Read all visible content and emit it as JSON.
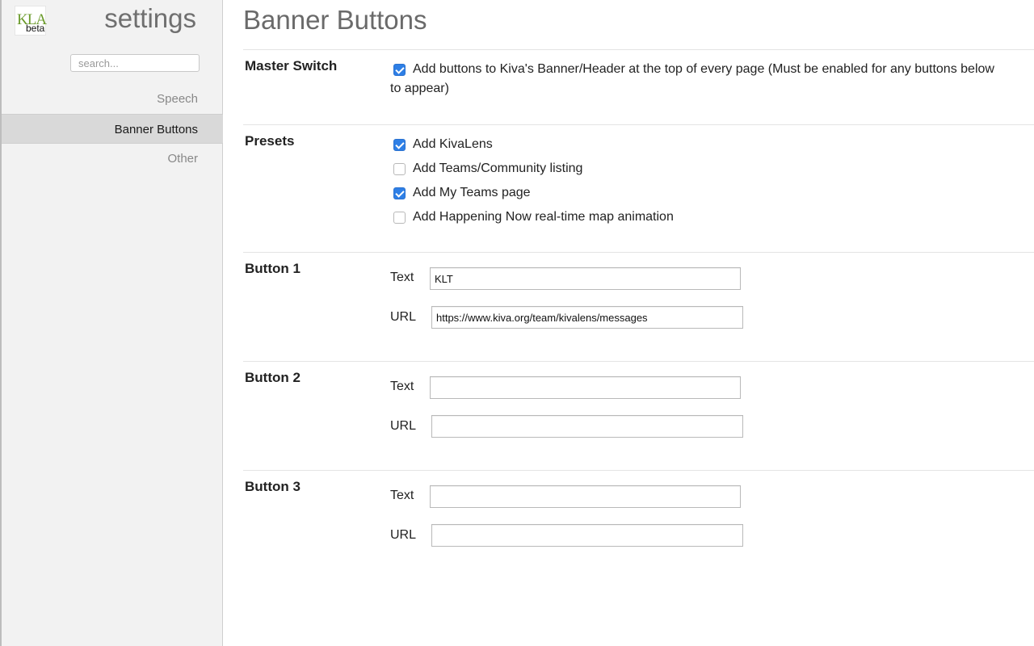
{
  "sidebar": {
    "logo_text": "KLA",
    "logo_beta": "beta",
    "title": "settings",
    "search_placeholder": "search...",
    "nav": [
      {
        "label": "Speech"
      },
      {
        "label": "Banner Buttons"
      },
      {
        "label": "Other"
      }
    ]
  },
  "main": {
    "title": "Banner Buttons",
    "master": {
      "label": "Master Switch",
      "checkbox_text": "Add buttons to Kiva's Banner/Header at the top of every page (Must be enabled for any buttons below to appear)",
      "checked": true
    },
    "presets": {
      "label": "Presets",
      "items": [
        {
          "label": "Add KivaLens",
          "checked": true
        },
        {
          "label": "Add Teams/Community listing",
          "checked": false
        },
        {
          "label": "Add My Teams page",
          "checked": true
        },
        {
          "label": "Add Happening Now real-time map animation",
          "checked": false
        }
      ]
    },
    "buttons": [
      {
        "label": "Button 1",
        "text_label": "Text",
        "url_label": "URL",
        "text_value": "KLT",
        "url_value": "https://www.kiva.org/team/kivalens/messages"
      },
      {
        "label": "Button 2",
        "text_label": "Text",
        "url_label": "URL",
        "text_value": "",
        "url_value": ""
      },
      {
        "label": "Button 3",
        "text_label": "Text",
        "url_label": "URL",
        "text_value": "",
        "url_value": ""
      }
    ]
  },
  "colors": {
    "accent_checkbox": "#2e7fe6",
    "logo_green": "#6a9a2a",
    "sidebar_bg": "#f2f2f2",
    "nav_active_bg": "#d9d9d9"
  }
}
